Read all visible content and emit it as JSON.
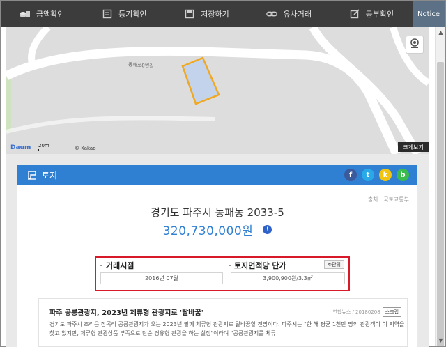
{
  "toolbar": {
    "items": [
      {
        "label": "금액확인",
        "icon": "coins-icon"
      },
      {
        "label": "등기확인",
        "icon": "document-icon"
      },
      {
        "label": "저장하기",
        "icon": "save-icon"
      },
      {
        "label": "유사거래",
        "icon": "link-icon"
      },
      {
        "label": "공부확인",
        "icon": "edit-icon"
      }
    ],
    "notice": "Notice"
  },
  "map": {
    "road_label": "동패로8번길",
    "logo": "Daum",
    "scale": "20m",
    "copyright": "© Kakao",
    "big_view": "크게보기"
  },
  "section": {
    "title": "토지",
    "share": [
      "f",
      "t",
      "k",
      "b"
    ]
  },
  "property": {
    "source": "출처 : 국토교통부",
    "address": "경기도 파주시 동패동 2033-5",
    "price": "320,730,000원",
    "info_icon": "!"
  },
  "transaction": {
    "time_label": "거래시점",
    "time_value": "2016년 07월",
    "unit_price_label": "토지면적당 단가",
    "unit_price_value": "3,900,900원/3.3㎡",
    "unit_button": "단위"
  },
  "news": {
    "title": "파주 공릉관광지, 2023년 체류형 관광지로 '탈바꿈'",
    "source_date": "연합뉴스 / 20180208",
    "scrap": "스크랩",
    "body": "경기도 파주시 조리읍 장곡리 공릉관광지가 오는 2023년 팔께 체류형 관광지로 탈바꿈할 전망이다. 파주시는 \"한 해 평균 1천만 명의 관광객이 이 지역을 찾고 있지만, 체류형 관광상품 부족으로 단순 경유형 관광을 하는 실정\"이라며 \"공릉관광지를 체류"
  },
  "colors": {
    "toolbar_bg": "#3c3c3c",
    "notice_bg": "#5c7185",
    "accent_blue": "#2f7fd3",
    "highlight_red": "#d8192a",
    "parcel_outline": "#f0a820",
    "parcel_fill": "#c3d3ec"
  }
}
